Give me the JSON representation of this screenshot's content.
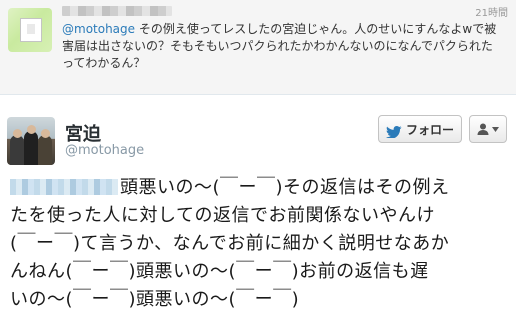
{
  "reply": {
    "time": "21時間",
    "text_mention": "@motohage",
    "text_rest": " その例え使ってレスしたの宮迫じゃん。人のせいにすんなよwで被害届は出さないの？そもそもいつパクられたかわかんないのになんでパクられたってわかるん？",
    "avatar_icon": "pixelated-avatar-icon"
  },
  "main_tweet": {
    "display_name": "宮迫",
    "screen_name": "@motohage",
    "follow_button": {
      "label": "フォロー",
      "icon": "twitter-bird-icon",
      "accent": "#2b7bb9"
    },
    "user_menu": {
      "icon": "user-icon",
      "caret_icon": "caret-down-icon"
    },
    "body_lines": [
      "頭悪いの～(￣ー￣)その返信はその例え",
      "たを使った人に対しての返信でお前関係ないやんけ",
      "(￣ー￣)て言うか、なんでお前に細かく説明せなあか",
      "んねん(￣ー￣)頭悪いの～(￣ー￣)お前の返信も遅",
      "いの～(￣ー￣)頭悪いの～(￣ー￣)"
    ]
  },
  "colors": {
    "link": "#2b7bb9",
    "muted": "#8899a6",
    "reply_bg": "#f5f5f5"
  }
}
